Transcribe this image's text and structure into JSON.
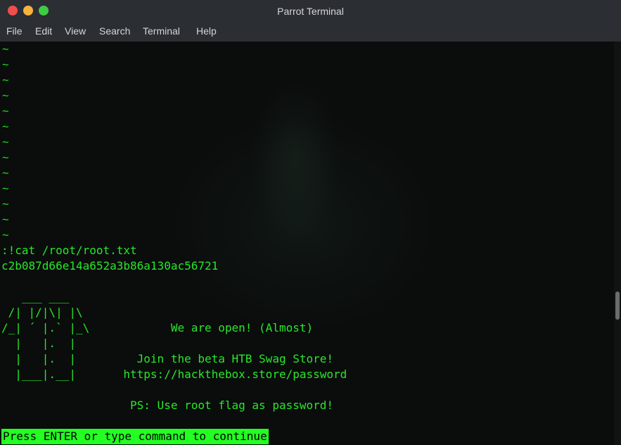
{
  "window": {
    "title": "Parrot Terminal"
  },
  "menu": [
    "File",
    "Edit",
    "View",
    "Search",
    "Terminal",
    "Help"
  ],
  "terminal": {
    "tilde": "~",
    "command": ":!cat /root/root.txt",
    "flag": "c2b087d66e14a652a3b86a130ac56721",
    "art_lines": [
      "   ___ ___",
      " /| |/|\\| |\\",
      "/_| ´ |.` |_\\            We are open! (Almost)",
      "  |   |.  |",
      "  |   |.  |         Join the beta HTB Swag Store!",
      "  |___|.__|       https://hackthebox.store/password",
      "",
      "                   PS: Use root flag as password!"
    ],
    "status": "Press ENTER or type command to continue"
  }
}
